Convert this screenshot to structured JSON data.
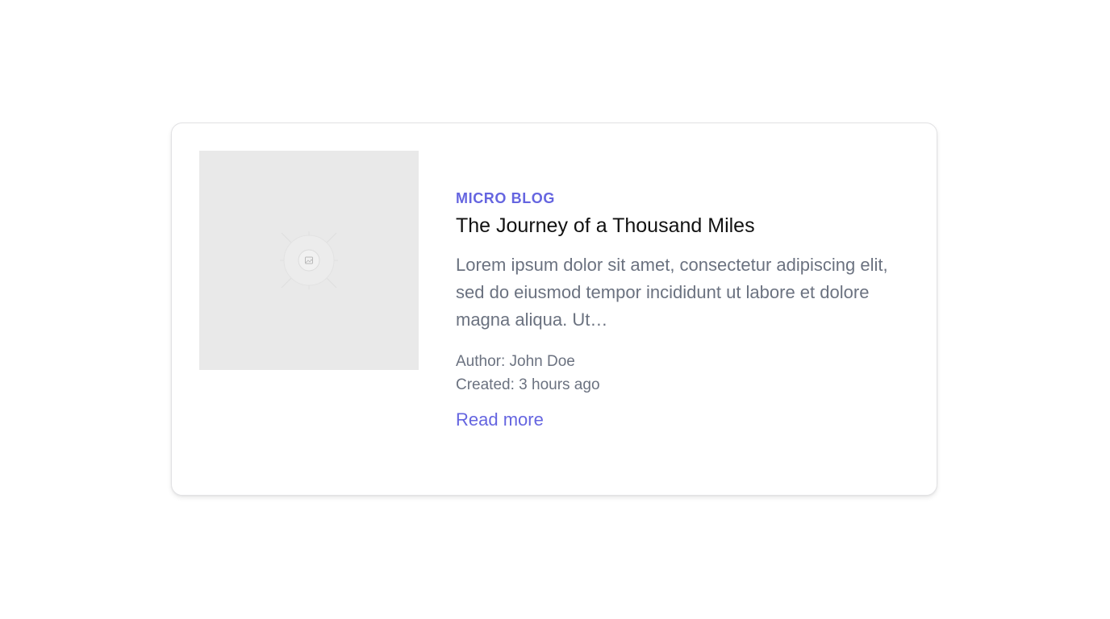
{
  "card": {
    "image_icon": "image-placeholder-icon",
    "category": "MICRO BLOG",
    "title": "The Journey of a Thousand Miles",
    "excerpt": "Lorem ipsum dolor sit amet, consectetur adipiscing elit, sed do eiusmod tempor incididunt ut labore et dolore magna aliqua. Ut…",
    "author_text": "Author: John Doe",
    "created_text": "Created: 3 hours ago",
    "read_more_label": "Read more"
  },
  "colors": {
    "accent": "#6565e0",
    "muted_text": "#6b7280",
    "title_text": "#111111",
    "placeholder_bg": "#e9e9e9",
    "card_border": "#e2e2e4"
  }
}
